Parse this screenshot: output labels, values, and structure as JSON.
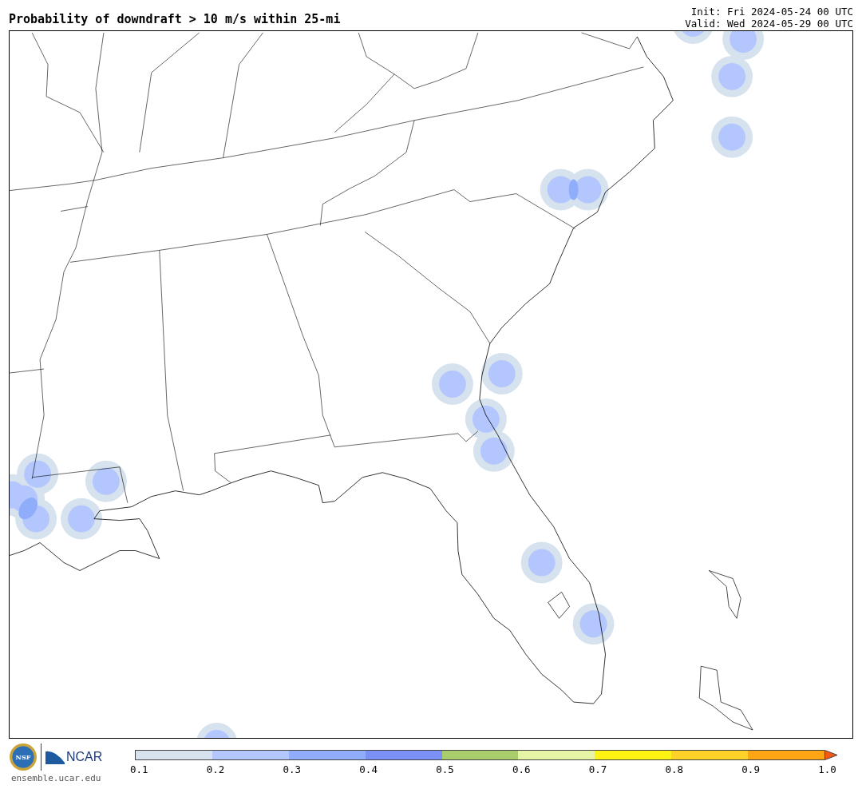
{
  "title": "Probability of downdraft > 10 m/s within 25-mi",
  "init": "Init: Fri 2024-05-24 00 UTC",
  "valid": "Valid: Wed 2024-05-29 00 UTC",
  "logos": {
    "nsf": "NSF",
    "ncar": "NCAR"
  },
  "site": "ensemble.ucar.edu",
  "colorbar": {
    "bins": [
      {
        "color": "#d6e2ed"
      },
      {
        "color": "#b3c7fe"
      },
      {
        "color": "#8fadfa"
      },
      {
        "color": "#7b90f5"
      },
      {
        "color": "#a8cd6a"
      },
      {
        "color": "#e6f5a5"
      },
      {
        "color": "#fff314"
      },
      {
        "color": "#ffd22a"
      },
      {
        "color": "#ffa514"
      }
    ],
    "extend": {
      "color": "#f05a14"
    },
    "ticks": [
      "0.1",
      "0.2",
      "0.3",
      "0.4",
      "0.5",
      "0.6",
      "0.7",
      "0.8",
      "0.9",
      "1.0"
    ]
  }
}
